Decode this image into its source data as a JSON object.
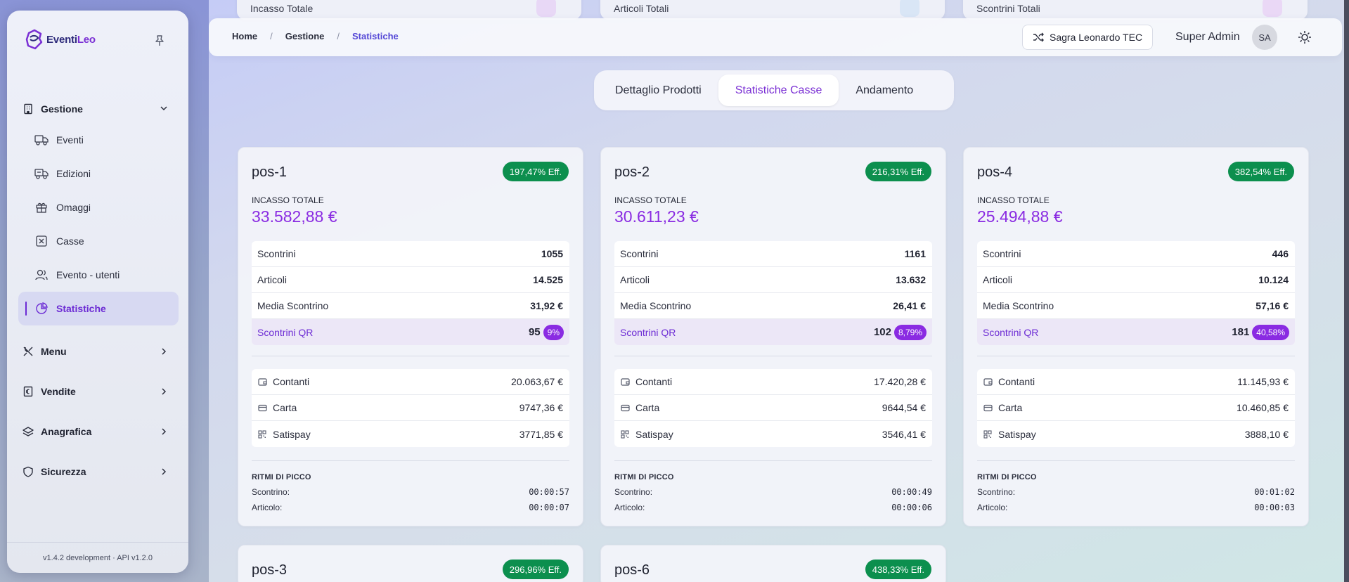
{
  "sidebar": {
    "logo": {
      "text_main": "Eventi",
      "text_accent": "Leo"
    },
    "groups": [
      {
        "label": "Gestione",
        "icon": "building-icon",
        "expanded": true,
        "items": [
          {
            "label": "Eventi",
            "icon": "truck-icon"
          },
          {
            "label": "Edizioni",
            "icon": "truck-alt-icon"
          },
          {
            "label": "Omaggi",
            "icon": "gift-icon"
          },
          {
            "label": "Casse",
            "icon": "cash-register-icon"
          },
          {
            "label": "Evento - utenti",
            "icon": "users-icon"
          },
          {
            "label": "Statistiche",
            "icon": "pie-chart-icon",
            "active": true
          }
        ]
      },
      {
        "label": "Menu",
        "icon": "utensils-icon"
      },
      {
        "label": "Vendite",
        "icon": "receipt-icon"
      },
      {
        "label": "Anagrafica",
        "icon": "layers-icon"
      },
      {
        "label": "Sicurezza",
        "icon": "shield-icon"
      }
    ],
    "version": "v1.4.2 development · API v1.2.0"
  },
  "peek": [
    "Incasso Totale",
    "Articoli Totali",
    "Scontrini Totali"
  ],
  "topbar": {
    "breadcrumbs": [
      "Home",
      "Gestione",
      "Statistiche"
    ],
    "event_label": "Sagra Leonardo TEC",
    "user_name": "Super Admin",
    "avatar_initials": "SA"
  },
  "tabs": [
    "Dettaglio Prodotti",
    "Statistiche Casse",
    "Andamento"
  ],
  "active_tab": "Statistiche Casse",
  "labels": {
    "incasso": "INCASSO TOTALE",
    "scontrini": "Scontrini",
    "articoli": "Articoli",
    "media": "Media Scontrino",
    "qr": "Scontrini QR",
    "contanti": "Contanti",
    "carta": "Carta",
    "satispay": "Satispay",
    "ritmi": "RITMI DI PICCO",
    "rit_scontrino": "Scontrino:",
    "rit_articolo": "Articolo:"
  },
  "cards": [
    {
      "name": "pos-1",
      "eff": "197,47% Eff.",
      "incasso": "33.582,88 €",
      "scontrini": "1055",
      "articoli": "14.525",
      "media": "31,92 €",
      "qr": "95",
      "qr_pct": "9%",
      "contanti": "20.063,67 €",
      "carta": "9747,36 €",
      "satispay": "3771,85 €",
      "rit_scontrino": "00:00:57",
      "rit_articolo": "00:00:07"
    },
    {
      "name": "pos-2",
      "eff": "216,31% Eff.",
      "incasso": "30.611,23 €",
      "scontrini": "1161",
      "articoli": "13.632",
      "media": "26,41 €",
      "qr": "102",
      "qr_pct": "8,79%",
      "contanti": "17.420,28 €",
      "carta": "9644,54 €",
      "satispay": "3546,41 €",
      "rit_scontrino": "00:00:49",
      "rit_articolo": "00:00:06"
    },
    {
      "name": "pos-4",
      "eff": "382,54% Eff.",
      "incasso": "25.494,88 €",
      "scontrini": "446",
      "articoli": "10.124",
      "media": "57,16 €",
      "qr": "181",
      "qr_pct": "40,58%",
      "contanti": "11.145,93 €",
      "carta": "10.460,85 €",
      "satispay": "3888,10 €",
      "rit_scontrino": "00:01:02",
      "rit_articolo": "00:00:03"
    },
    {
      "name": "pos-3",
      "eff": "296,96% Eff."
    },
    {
      "name": "pos-6",
      "eff": "438,33% Eff."
    }
  ],
  "colors": {
    "accent": "#8a2be2",
    "eff_badge": "#0c8f4e",
    "breadcrumb_current": "#5548d6"
  }
}
